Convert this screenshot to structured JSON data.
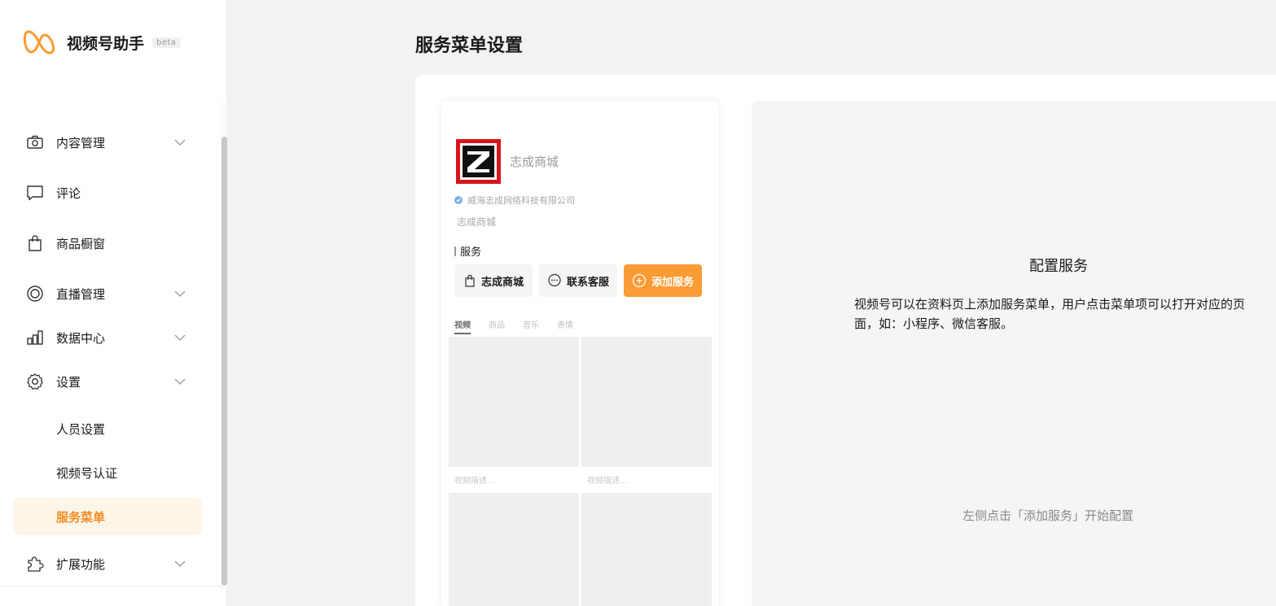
{
  "brand": {
    "name": "视频号助手",
    "badge": "beta",
    "accent": "#f99c34"
  },
  "sidebar": {
    "items": [
      {
        "label": "内容管理",
        "icon": "camera-icon",
        "expandable": true
      },
      {
        "label": "评论",
        "icon": "comment-icon",
        "expandable": false
      },
      {
        "label": "商品橱窗",
        "icon": "shopping-bag-icon",
        "expandable": false
      },
      {
        "label": "直播管理",
        "icon": "live-icon",
        "expandable": true
      },
      {
        "label": "数据中心",
        "icon": "bar-chart-icon",
        "expandable": true
      },
      {
        "label": "设置",
        "icon": "gear-icon",
        "expandable": true,
        "expanded": true
      },
      {
        "label": "扩展功能",
        "icon": "puzzle-icon",
        "expandable": true
      }
    ],
    "settings_children": [
      {
        "label": "人员设置"
      },
      {
        "label": "视频号认证"
      },
      {
        "label": "服务菜单",
        "active": true
      }
    ]
  },
  "page": {
    "title": "服务菜单设置"
  },
  "preview": {
    "account_name": "志成商城",
    "verified_company": "威海志成网络科技有限公司",
    "description": "志成商城",
    "services_title": "服务",
    "services": [
      {
        "label": "志成商城",
        "icon": "shopping-bag-icon"
      },
      {
        "label": "联系客服",
        "icon": "chat-bubble-icon"
      }
    ],
    "add_service_label": "添加服务",
    "tabs": [
      "视频",
      "商品",
      "音乐",
      "表情"
    ],
    "active_tab": "视频",
    "video_captions": [
      "视频描述...",
      "视频描述..."
    ]
  },
  "config": {
    "title": "配置服务",
    "description": "视频号可以在资料页上添加服务菜单，用户点击菜单项可以打开对应的页面，如：小程序、微信客服。",
    "hint": "左侧点击「添加服务」开始配置"
  }
}
